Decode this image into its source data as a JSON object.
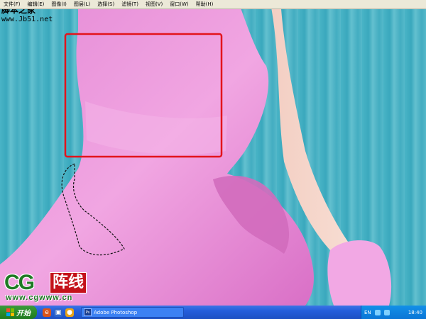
{
  "menubar": {
    "items": [
      "文件(F)",
      "编辑(E)",
      "图像(I)",
      "图层(L)",
      "选择(S)",
      "滤镜(T)",
      "视图(V)",
      "窗口(W)",
      "帮助(H)"
    ]
  },
  "watermark": {
    "site_name": "脚本之家",
    "site_url": "www.Jb51.net"
  },
  "logo": {
    "cg_text": "CG",
    "cn_text": "阵线",
    "url": "www.cgwww.cn"
  },
  "taskbar": {
    "start_label": "开始",
    "task_label": "Adobe Photoshop",
    "language": "EN",
    "clock": "18:40"
  },
  "colors": {
    "dress": "#e27fd0",
    "selection_rect": "#e3141c",
    "background": "#3aa9bd"
  },
  "icons": {
    "start": "windows-flag-icon",
    "photoshop": "photoshop-icon"
  }
}
